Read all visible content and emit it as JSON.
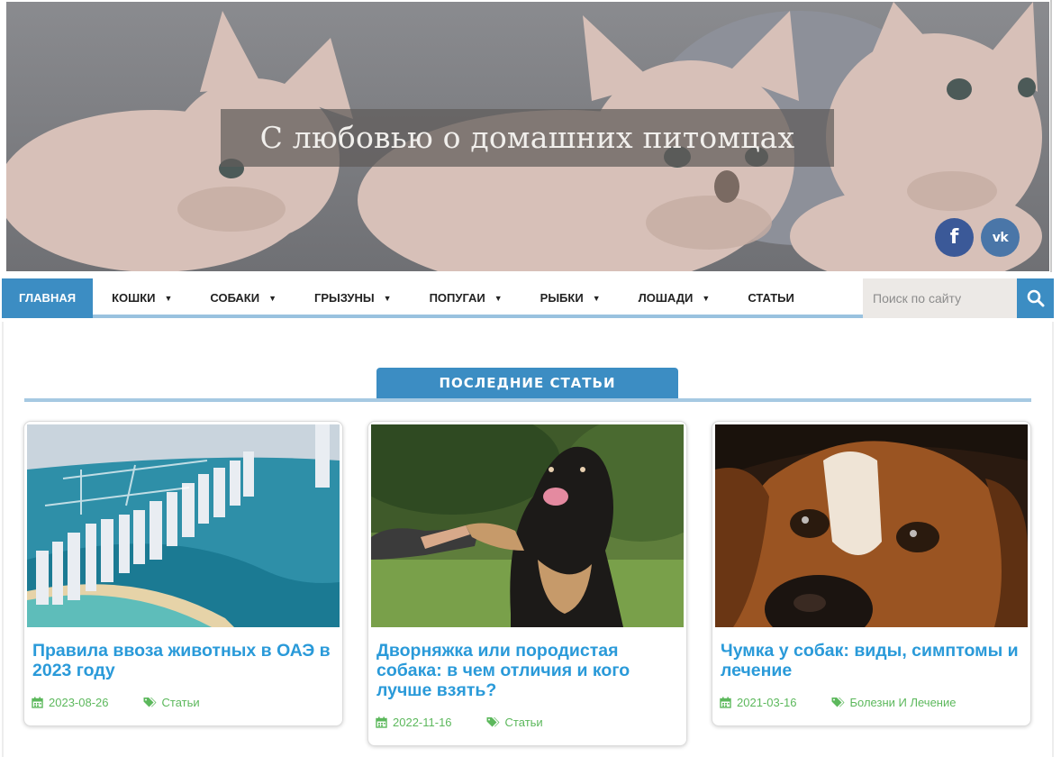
{
  "header": {
    "site_title": "С любовью о домашних питомцах",
    "social": [
      {
        "name": "facebook",
        "glyph": "f",
        "color": "#3b5998"
      },
      {
        "name": "vkontakte",
        "glyph": "vk",
        "color": "#4a76a8"
      }
    ]
  },
  "nav": {
    "items": [
      {
        "label": "Главная",
        "active": true,
        "dropdown": false
      },
      {
        "label": "Кошки",
        "active": false,
        "dropdown": true
      },
      {
        "label": "Собаки",
        "active": false,
        "dropdown": true
      },
      {
        "label": "Грызуны",
        "active": false,
        "dropdown": true
      },
      {
        "label": "Попугаи",
        "active": false,
        "dropdown": true
      },
      {
        "label": "Рыбки",
        "active": false,
        "dropdown": true
      },
      {
        "label": "Лошади",
        "active": false,
        "dropdown": true
      },
      {
        "label": "Статьи",
        "active": false,
        "dropdown": false
      }
    ],
    "search_placeholder": "Поиск по сайту",
    "search_icon": "magnifier-icon"
  },
  "latest": {
    "heading": "ПОСЛЕДНИЕ СТАТЬИ",
    "articles": [
      {
        "title": "Правила ввоза животных в ОАЭ в 2023 году",
        "date": "2023-08-26",
        "category": "Статьи",
        "image": "dubai-marina-aerial"
      },
      {
        "title": "Дворняжка или породистая собака: в чем отличия и кого лучше взять?",
        "date": "2022-11-16",
        "category": "Статьи",
        "image": "dog-giving-paw"
      },
      {
        "title": "Чумка у собак: виды, симптомы и лечение",
        "date": "2021-03-16",
        "category": "Болезни И Лечение",
        "image": "beagle-closeup"
      }
    ]
  },
  "colors": {
    "accent": "#3c8dc3",
    "accent_light": "#a6c9e2",
    "link": "#2a9ad9",
    "meta": "#5cb85c"
  }
}
